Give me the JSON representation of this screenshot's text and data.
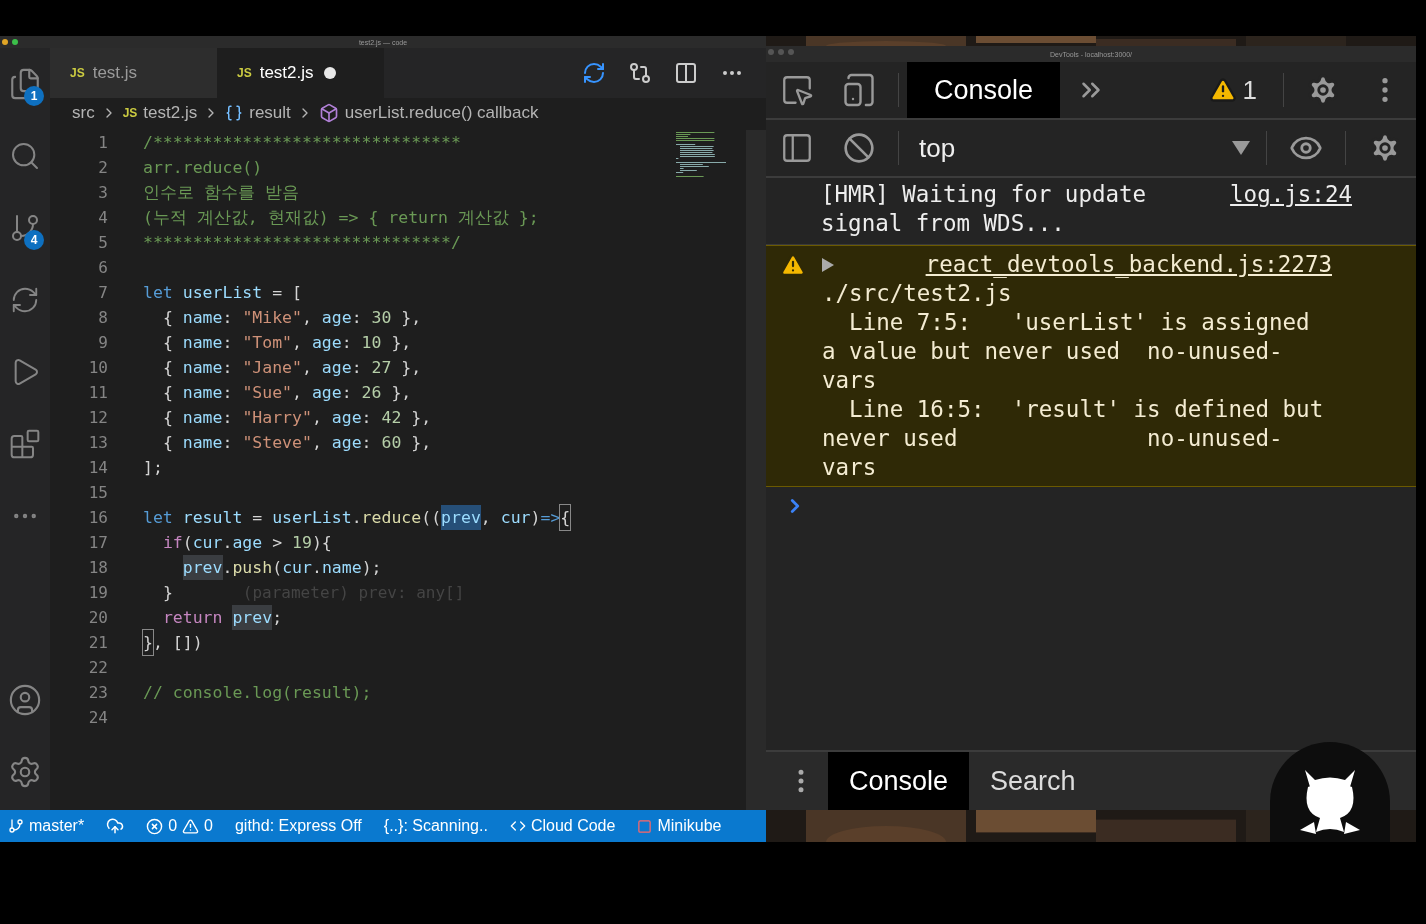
{
  "editor_window": {
    "title": "test2.js — code",
    "activity_badges": {
      "explorer": "1",
      "source_control": "4"
    },
    "tabs": [
      {
        "icon_text": "JS",
        "label": "test.js",
        "selected": false,
        "modified": false
      },
      {
        "icon_text": "JS",
        "label": "test2.js",
        "selected": true,
        "modified": true
      }
    ],
    "breadcrumb": {
      "folder": "src",
      "file_icon_text": "JS",
      "file": "test2.js",
      "symbol": "result",
      "callback": "userList.reduce() callback"
    },
    "lines": [
      {
        "n": "1",
        "tokens": [
          {
            "kind": "cm",
            "text": "/*******************************"
          }
        ]
      },
      {
        "n": "2",
        "tokens": [
          {
            "kind": "cm",
            "text": "arr.reduce()"
          }
        ]
      },
      {
        "n": "3",
        "tokens": [
          {
            "kind": "cm",
            "text": "인수로 함수를 받음"
          }
        ]
      },
      {
        "n": "4",
        "tokens": [
          {
            "kind": "cm",
            "text": "(누적 계산값, 현재값) => { return 계산값 };"
          }
        ]
      },
      {
        "n": "5",
        "tokens": [
          {
            "kind": "cm",
            "text": "*******************************/"
          }
        ]
      },
      {
        "n": "6"
      },
      {
        "n": "7",
        "tokens": [
          {
            "kind": "kw",
            "text": "let "
          },
          {
            "kind": "var",
            "text": "userList"
          },
          {
            "kind": "pn",
            "text": " = ["
          }
        ]
      },
      {
        "n": "8",
        "tokens": [
          {
            "kind": "pn",
            "text": "  { "
          },
          {
            "kind": "var",
            "text": "name"
          },
          {
            "kind": "pn",
            "text": ": "
          },
          {
            "kind": "str",
            "text": "\"Mike\""
          },
          {
            "kind": "pn",
            "text": ", "
          },
          {
            "kind": "var",
            "text": "age"
          },
          {
            "kind": "pn",
            "text": ": "
          },
          {
            "kind": "num",
            "text": "30"
          },
          {
            "kind": "pn",
            "text": " },"
          }
        ]
      },
      {
        "n": "9",
        "tokens": [
          {
            "kind": "pn",
            "text": "  { "
          },
          {
            "kind": "var",
            "text": "name"
          },
          {
            "kind": "pn",
            "text": ": "
          },
          {
            "kind": "str",
            "text": "\"Tom\""
          },
          {
            "kind": "pn",
            "text": ", "
          },
          {
            "kind": "var",
            "text": "age"
          },
          {
            "kind": "pn",
            "text": ": "
          },
          {
            "kind": "num",
            "text": "10"
          },
          {
            "kind": "pn",
            "text": " },"
          }
        ]
      },
      {
        "n": "10",
        "tokens": [
          {
            "kind": "pn",
            "text": "  { "
          },
          {
            "kind": "var",
            "text": "name"
          },
          {
            "kind": "pn",
            "text": ": "
          },
          {
            "kind": "str",
            "text": "\"Jane\""
          },
          {
            "kind": "pn",
            "text": ", "
          },
          {
            "kind": "var",
            "text": "age"
          },
          {
            "kind": "pn",
            "text": ": "
          },
          {
            "kind": "num",
            "text": "27"
          },
          {
            "kind": "pn",
            "text": " },"
          }
        ]
      },
      {
        "n": "11",
        "tokens": [
          {
            "kind": "pn",
            "text": "  { "
          },
          {
            "kind": "var",
            "text": "name"
          },
          {
            "kind": "pn",
            "text": ": "
          },
          {
            "kind": "str",
            "text": "\"Sue\""
          },
          {
            "kind": "pn",
            "text": ", "
          },
          {
            "kind": "var",
            "text": "age"
          },
          {
            "kind": "pn",
            "text": ": "
          },
          {
            "kind": "num",
            "text": "26"
          },
          {
            "kind": "pn",
            "text": " },"
          }
        ]
      },
      {
        "n": "12",
        "tokens": [
          {
            "kind": "pn",
            "text": "  { "
          },
          {
            "kind": "var",
            "text": "name"
          },
          {
            "kind": "pn",
            "text": ": "
          },
          {
            "kind": "str",
            "text": "\"Harry\""
          },
          {
            "kind": "pn",
            "text": ", "
          },
          {
            "kind": "var",
            "text": "age"
          },
          {
            "kind": "pn",
            "text": ": "
          },
          {
            "kind": "num",
            "text": "42"
          },
          {
            "kind": "pn",
            "text": " },"
          }
        ]
      },
      {
        "n": "13",
        "tokens": [
          {
            "kind": "pn",
            "text": "  { "
          },
          {
            "kind": "var",
            "text": "name"
          },
          {
            "kind": "pn",
            "text": ": "
          },
          {
            "kind": "str",
            "text": "\"Steve\""
          },
          {
            "kind": "pn",
            "text": ", "
          },
          {
            "kind": "var",
            "text": "age"
          },
          {
            "kind": "pn",
            "text": ": "
          },
          {
            "kind": "num",
            "text": "60"
          },
          {
            "kind": "pn",
            "text": " },"
          }
        ]
      },
      {
        "n": "14",
        "tokens": [
          {
            "kind": "pn",
            "text": "];"
          }
        ]
      },
      {
        "n": "15"
      },
      {
        "n": "16",
        "tokens": [
          {
            "kind": "kw",
            "text": "let "
          },
          {
            "kind": "var",
            "text": "result"
          },
          {
            "kind": "pn",
            "text": " = "
          },
          {
            "kind": "var",
            "text": "userList"
          },
          {
            "kind": "pn",
            "text": "."
          },
          {
            "kind": "fn",
            "text": "reduce"
          },
          {
            "kind": "pn",
            "text": "(("
          },
          {
            "kind": "hl",
            "text": "prev"
          },
          {
            "kind": "pn",
            "text": ", "
          },
          {
            "kind": "var",
            "text": "cur"
          },
          {
            "kind": "pn",
            "text": ")"
          },
          {
            "kind": "kw",
            "text": "=>"
          },
          {
            "kind": "br",
            "text": "{"
          }
        ]
      },
      {
        "n": "17",
        "tokens": [
          {
            "kind": "ctl",
            "text": "  if"
          },
          {
            "kind": "pn",
            "text": "("
          },
          {
            "kind": "var",
            "text": "cur"
          },
          {
            "kind": "pn",
            "text": "."
          },
          {
            "kind": "var",
            "text": "age"
          },
          {
            "kind": "pn",
            "text": " > "
          },
          {
            "kind": "num",
            "text": "19"
          },
          {
            "kind": "pn",
            "text": "){"
          }
        ]
      },
      {
        "n": "18",
        "tokens": [
          {
            "kind": "ref",
            "text": "    prev"
          },
          {
            "kind": "pn",
            "text": "."
          },
          {
            "kind": "fn",
            "text": "push"
          },
          {
            "kind": "pn",
            "text": "("
          },
          {
            "kind": "var",
            "text": "cur"
          },
          {
            "kind": "pn",
            "text": "."
          },
          {
            "kind": "var",
            "text": "name"
          },
          {
            "kind": "pn",
            "text": ");"
          }
        ]
      },
      {
        "n": "19",
        "tokens": [
          {
            "kind": "pn",
            "text": "  }"
          }
        ],
        "ghost": "(parameter) prev: any[]"
      },
      {
        "n": "20",
        "tokens": [
          {
            "kind": "ctl",
            "text": "  return "
          },
          {
            "kind": "ref",
            "text": "prev"
          },
          {
            "kind": "pn",
            "text": ";"
          }
        ]
      },
      {
        "n": "21",
        "tokens": [
          {
            "kind": "br",
            "text": "}"
          },
          {
            "kind": "pn",
            "text": ", [])"
          }
        ]
      },
      {
        "n": "22"
      },
      {
        "n": "23",
        "tokens": [
          {
            "kind": "cm",
            "text": "// console.log(result);"
          }
        ]
      },
      {
        "n": "24"
      }
    ],
    "status_bar": {
      "branch": "master*",
      "errors": "0",
      "warnings": "0",
      "githd": "githd: Express Off",
      "scanning": "{..}: Scanning..",
      "cloud_code": "Cloud Code",
      "minikube": "Minikube"
    }
  },
  "devtools": {
    "title": "DevTools - localhost:3000/",
    "tabs": [
      {
        "label": "Console",
        "selected": true
      }
    ],
    "warning_count": "1",
    "context": "top",
    "messages": [
      {
        "kind": "log",
        "source": "log.js:24",
        "text": "[HMR] Waiting for update signal from WDS..."
      },
      {
        "kind": "warning",
        "source": "react_devtools_backend.js:2273",
        "text": "./src/test2.js\n  Line 7:5:   'userList' is assigned a value but never used  no-unused-vars\n  Line 16:5:  'result' is defined but never used              no-unused-vars"
      }
    ],
    "drawer_tabs": [
      {
        "label": "Console",
        "selected": true
      },
      {
        "label": "Search",
        "selected": false
      }
    ]
  }
}
